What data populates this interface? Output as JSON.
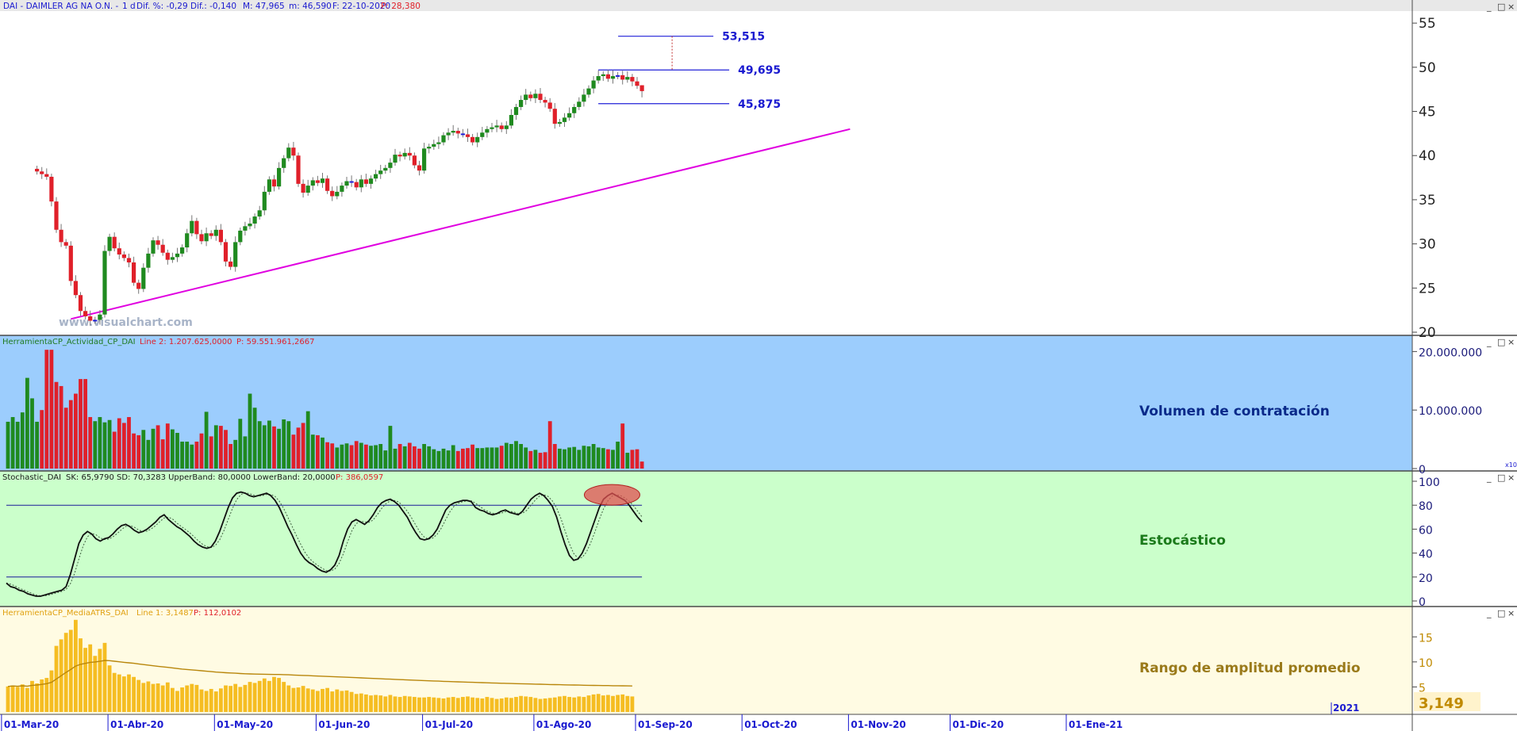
{
  "colors": {
    "up": "#1f8a1f",
    "down": "#e0202a",
    "neutral": "#2020d8",
    "trendline": "#e000e0",
    "level_line": "#2020d8",
    "volume_bg": "#9ccdfd",
    "stoch_bg": "#cbffcb",
    "atr_bg": "#fffbe3",
    "atr_bar": "#f5bd22",
    "atr_avg": "#b8860b",
    "stoch_k": "#101010",
    "stoch_d": "#406040",
    "highlight": "#e05050"
  },
  "window_controls": [
    "_",
    "□",
    "×"
  ],
  "price_panel": {
    "header": {
      "symbol": "DAI - DAIMLER AG NA O.N. -",
      "period": "1 d",
      "diff_pct": "Dif. %: -0,29",
      "diff": "Dif.: -0,140",
      "max": "M: 47,965",
      "min": "m: 46,590",
      "date": "F: 22-10-2020",
      "p": "P: 28,380"
    },
    "watermark": "www.visualchart.com",
    "levels": [
      {
        "value": 53.515,
        "label": "53,515"
      },
      {
        "value": 49.695,
        "label": "49,695"
      },
      {
        "value": 45.875,
        "label": "45,875"
      }
    ],
    "y_ticks": [
      "55",
      "50",
      "45",
      "40",
      "35",
      "30",
      "25",
      "20"
    ]
  },
  "volume_panel": {
    "header_name": "HerramientaCP_Actividad_CP_DAI",
    "header_line": "Line 2: 1.207.625,0000",
    "header_p": "P: 59.551.961,2667",
    "title": "Volumen de contratación",
    "y_ticks": [
      "20.000.000",
      "10.000.000",
      "0"
    ],
    "scale_tag": "x10"
  },
  "stoch_panel": {
    "header_name": "Stochastic_DAI",
    "header_vals": "SK: 65,9790  SD: 70,3283  UpperBand: 80,0000  LowerBand: 20,0000",
    "header_p": "P: 386,0597",
    "title": "Estocástico",
    "upper_band": 80,
    "lower_band": 20,
    "y_ticks": [
      "100",
      "80",
      "60",
      "40",
      "20",
      "0"
    ]
  },
  "atr_panel": {
    "header_name": "HerramientaCP_MediaATRS_DAI",
    "header_line": "Line 1: 3,1487",
    "header_p": "P: 112,0102",
    "title": "Rango de amplitud promedio",
    "last_value": "3,149",
    "y_ticks": [
      "15",
      "10",
      "5"
    ]
  },
  "x_axis": {
    "labels": [
      "01-Mar-20",
      "01-Abr-20",
      "01-May-20",
      "01-Jun-20",
      "01-Jul-20",
      "01-Ago-20",
      "01-Sep-20",
      "01-Oct-20",
      "01-Nov-20",
      "01-Dic-20",
      "01-Ene-21"
    ],
    "year_label": "2021"
  },
  "chart_data": [
    {
      "type": "candlestick",
      "title": "DAI - DAIMLER AG NA O.N.",
      "period": "1 d",
      "ylim": [
        20,
        56
      ],
      "x_start": "2020-03-02",
      "last_date": "2020-10-22",
      "last_bar": {
        "max": 47.965,
        "min": 46.59
      },
      "trendline": [
        {
          "date": "2020-03-19",
          "value": 21.5
        },
        {
          "date": "2020-10-30",
          "value": 43.0
        }
      ],
      "levels": [
        53.515,
        49.695,
        45.875
      ],
      "closes": [
        38.2,
        37.9,
        37.6,
        34.8,
        31.6,
        30.2,
        29.8,
        25.8,
        24.2,
        22.4,
        21.8,
        21.3,
        21.4,
        22.0,
        29.2,
        30.8,
        29.5,
        28.8,
        28.4,
        27.9,
        25.6,
        24.9,
        27.3,
        28.9,
        30.4,
        29.9,
        29.0,
        28.2,
        28.5,
        28.9,
        29.6,
        31.2,
        32.6,
        31.1,
        30.3,
        31.2,
        30.9,
        31.6,
        30.2,
        28.0,
        27.4,
        30.2,
        31.5,
        32.0,
        32.3,
        33.1,
        33.8,
        35.9,
        37.3,
        36.5,
        38.6,
        39.7,
        40.9,
        40.0,
        36.8,
        35.8,
        36.6,
        37.2,
        36.9,
        37.4,
        36.0,
        35.4,
        35.9,
        36.6,
        37.1,
        37.0,
        36.4,
        37.3,
        36.8,
        37.4,
        37.9,
        38.3,
        38.6,
        39.2,
        40.1,
        39.9,
        40.3,
        40.0,
        38.9,
        38.3,
        40.8,
        41.0,
        41.3,
        41.5,
        42.3,
        42.6,
        42.8,
        42.5,
        42.4,
        42.1,
        41.5,
        42.1,
        42.6,
        43.0,
        43.2,
        43.4,
        43.0,
        43.4,
        44.6,
        45.5,
        46.3,
        46.9,
        46.5,
        47.0,
        46.3,
        46.0,
        45.3,
        43.6,
        43.8,
        44.3,
        44.8,
        45.5,
        46.1,
        46.9,
        47.6,
        48.5,
        49.0,
        49.2,
        48.7,
        49.0,
        49.1,
        48.6,
        48.9,
        48.4,
        47.9,
        47.3
      ]
    },
    {
      "type": "bar",
      "title": "Volumen de contratación",
      "ylim": [
        0,
        21000000
      ],
      "last_value": 1207625,
      "values": [
        8000000,
        8800000,
        8000000,
        9600000,
        15500000,
        12000000,
        8000000,
        10000000,
        20300000,
        20300000,
        14800000,
        14100000,
        10400000,
        11700000,
        12800000,
        15300000,
        15300000,
        8800000,
        8100000,
        8800000,
        7900000,
        8300000,
        6300000,
        8600000,
        7800000,
        8800000,
        6000000,
        5700000,
        6600000,
        4900000,
        6800000,
        7400000,
        5000000,
        7700000,
        6700000,
        6100000,
        4600000,
        4600000,
        4100000,
        4600000,
        6000000,
        9700000,
        5500000,
        7400000,
        7300000,
        6600000,
        4200000,
        4900000,
        8500000,
        5500000,
        12800000,
        10400000,
        8100000,
        7400000,
        8200000,
        7200000,
        6800000,
        8400000,
        8100000,
        5800000,
        7000000,
        7800000,
        9800000,
        5800000,
        5700000,
        5300000,
        4500000,
        4300000,
        3600000,
        4100000,
        4300000,
        4000000,
        4700000,
        4400000,
        4100000,
        3900000,
        4000000,
        4200000,
        3100000,
        7300000,
        3400000,
        4200000,
        3800000,
        4400000,
        3800000,
        3400000,
        4200000,
        3800000,
        3300000,
        3000000,
        3400000,
        3100000,
        4000000,
        3000000,
        3400000,
        3500000,
        4100000,
        3500000,
        3500000,
        3600000,
        3600000,
        3600000,
        3900000,
        4400000,
        4200000,
        4700000,
        4200000,
        3600000,
        3000000,
        3200000,
        2700000,
        2800000,
        8100000,
        4200000,
        3400000,
        3300000,
        3600000,
        3700000,
        3200000,
        3900000,
        3800000,
        4200000,
        3600000,
        3500000,
        3300000,
        3200000,
        4600000,
        7700000,
        2700000,
        3200000,
        3300000,
        1200000
      ]
    },
    {
      "type": "line",
      "title": "Estocástico",
      "ylim": [
        0,
        100
      ],
      "bands": [
        20,
        80
      ],
      "last": {
        "SK": 65.979,
        "SD": 70.3283
      },
      "sk": [
        15,
        12,
        11,
        9,
        8,
        6,
        5,
        4,
        4,
        5,
        6,
        7,
        8,
        9,
        12,
        22,
        35,
        48,
        55,
        58,
        56,
        52,
        50,
        52,
        53,
        56,
        60,
        63,
        64,
        62,
        59,
        57,
        58,
        60,
        63,
        66,
        70,
        72,
        68,
        65,
        62,
        60,
        57,
        54,
        50,
        47,
        45,
        44,
        45,
        50,
        58,
        68,
        78,
        86,
        90,
        91,
        90,
        88,
        87,
        88,
        89,
        90,
        88,
        84,
        78,
        70,
        62,
        55,
        47,
        40,
        35,
        32,
        30,
        27,
        25,
        24,
        26,
        30,
        38,
        50,
        60,
        66,
        68,
        66,
        64,
        67,
        72,
        78,
        82,
        84,
        85,
        83,
        80,
        75,
        70,
        63,
        57,
        52,
        51,
        52,
        55,
        60,
        68,
        76,
        80,
        82,
        83,
        84,
        84,
        83,
        78,
        76,
        75,
        73,
        72,
        73,
        75,
        76,
        74,
        73,
        72,
        75,
        80,
        85,
        88,
        90,
        88,
        84,
        79,
        70,
        58,
        47,
        38,
        34,
        35,
        40,
        48,
        58,
        68,
        78,
        85,
        88,
        90,
        88,
        86,
        84,
        80,
        75,
        70,
        66
      ]
    },
    {
      "type": "bar",
      "title": "Rango de amplitud promedio",
      "ylim": [
        0,
        19
      ],
      "last_value": 3.1487,
      "values": [
        5.1,
        5.3,
        5.0,
        5.5,
        4.8,
        6.2,
        5.7,
        6.5,
        6.8,
        8.3,
        13.2,
        14.5,
        15.8,
        16.4,
        18.4,
        14.7,
        12.8,
        13.5,
        11.2,
        12.6,
        13.8,
        9.3,
        7.8,
        7.5,
        7.1,
        7.5,
        7.0,
        6.4,
        5.8,
        6.1,
        5.6,
        5.7,
        5.3,
        5.9,
        4.8,
        4.2,
        4.9,
        5.3,
        5.6,
        5.4,
        4.5,
        4.2,
        4.6,
        4.1,
        4.7,
        5.3,
        5.2,
        5.6,
        5.0,
        5.4,
        6.0,
        5.8,
        6.2,
        6.7,
        6.2,
        7.0,
        6.8,
        6.0,
        5.3,
        4.8,
        4.9,
        5.2,
        4.7,
        4.5,
        4.2,
        4.6,
        4.8,
        4.1,
        4.5,
        4.2,
        4.3,
        4.0,
        3.6,
        3.7,
        3.5,
        3.3,
        3.4,
        3.3,
        3.1,
        3.4,
        3.1,
        3.0,
        3.2,
        3.1,
        3.0,
        2.9,
        2.9,
        3.0,
        2.9,
        2.8,
        2.7,
        2.9,
        3.0,
        2.8,
        3.0,
        3.1,
        2.9,
        2.8,
        2.7,
        3.0,
        2.8,
        2.6,
        2.7,
        2.9,
        2.8,
        3.0,
        3.2,
        3.1,
        3.0,
        2.8,
        2.6,
        2.7,
        2.8,
        2.9,
        3.1,
        3.2,
        3.0,
        2.9,
        3.1,
        3.0,
        3.3,
        3.5,
        3.6,
        3.3,
        3.4,
        3.2,
        3.4,
        3.5,
        3.2,
        3.1
      ]
    }
  ]
}
